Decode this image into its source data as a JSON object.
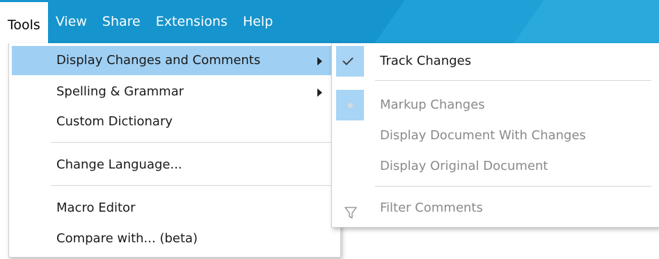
{
  "menubar": {
    "items": [
      "Tools",
      "View",
      "Share",
      "Extensions",
      "Help"
    ],
    "active": "Tools"
  },
  "tools_menu": {
    "items": [
      {
        "label": "Display Changes and Comments",
        "submenu": true,
        "highlighted": true
      },
      {
        "label": "Spelling & Grammar",
        "submenu": true
      },
      {
        "label": "Custom Dictionary"
      },
      {
        "label": "Change Language..."
      },
      {
        "label": "Macro Editor"
      },
      {
        "label": "Compare with... (beta)"
      }
    ]
  },
  "submenu": {
    "track_changes": {
      "label": "Track Changes",
      "checked": true,
      "icon": "check-icon"
    },
    "markup_changes": {
      "label": "Markup Changes",
      "selected": true,
      "icon": "radio-dot-icon"
    },
    "display_with_changes": {
      "label": "Display Document With Changes"
    },
    "display_original": {
      "label": "Display Original Document"
    },
    "filter_comments": {
      "label": "Filter Comments",
      "icon": "filter-icon"
    }
  },
  "colors": {
    "menubar": "#1694cd",
    "highlight": "#9fcff3",
    "disabled_text": "#8a8a8a"
  }
}
